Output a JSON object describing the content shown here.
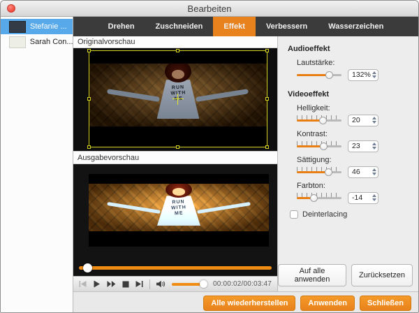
{
  "window": {
    "title": "Bearbeiten"
  },
  "sidebar": {
    "items": [
      {
        "label": "Stefanie ...",
        "selected": true
      },
      {
        "label": "Sarah Con...",
        "selected": false
      }
    ]
  },
  "tabs": [
    {
      "label": "Drehen",
      "active": false
    },
    {
      "label": "Zuschneiden",
      "active": false
    },
    {
      "label": "Effekt",
      "active": true
    },
    {
      "label": "Verbessern",
      "active": false
    },
    {
      "label": "Wasserzeichen",
      "active": false
    }
  ],
  "previews": {
    "original_label": "Originalvorschau",
    "output_label": "Ausgabevorschau",
    "shirt_lines": [
      "RUN",
      "WITH",
      "ME"
    ]
  },
  "transport": {
    "time": "00:00:02/00:03:47",
    "volume_pct": 80,
    "seek_pct": 2
  },
  "effects": {
    "audio": {
      "heading": "Audioeffekt",
      "controls": [
        {
          "label": "Lautstärke:",
          "value": "132%",
          "fill_pct": 72
        }
      ]
    },
    "video": {
      "heading": "Videoeffekt",
      "controls": [
        {
          "label": "Helligkeit:",
          "value": "20",
          "fill_pct": 58
        },
        {
          "label": "Kontrast:",
          "value": "23",
          "fill_pct": 60
        },
        {
          "label": "Sättigung:",
          "value": "46",
          "fill_pct": 71
        },
        {
          "label": "Farbton:",
          "value": "-14",
          "fill_pct": 38
        }
      ]
    },
    "deinterlacing": {
      "label": "Deinterlacing",
      "checked": false
    },
    "panel_buttons": [
      {
        "label": "Auf alle anwenden"
      },
      {
        "label": "Zurücksetzen"
      }
    ]
  },
  "footer_buttons": [
    {
      "label": "Alle wiederherstellen"
    },
    {
      "label": "Anwenden"
    },
    {
      "label": "Schließen"
    }
  ],
  "colors": {
    "accent_orange": "#e8821c",
    "tab_bar": "#3b3b3b",
    "selection_blue": "#57a9ea",
    "crop_yellow": "#d4d41f",
    "slider_fill": "#e87f12"
  }
}
